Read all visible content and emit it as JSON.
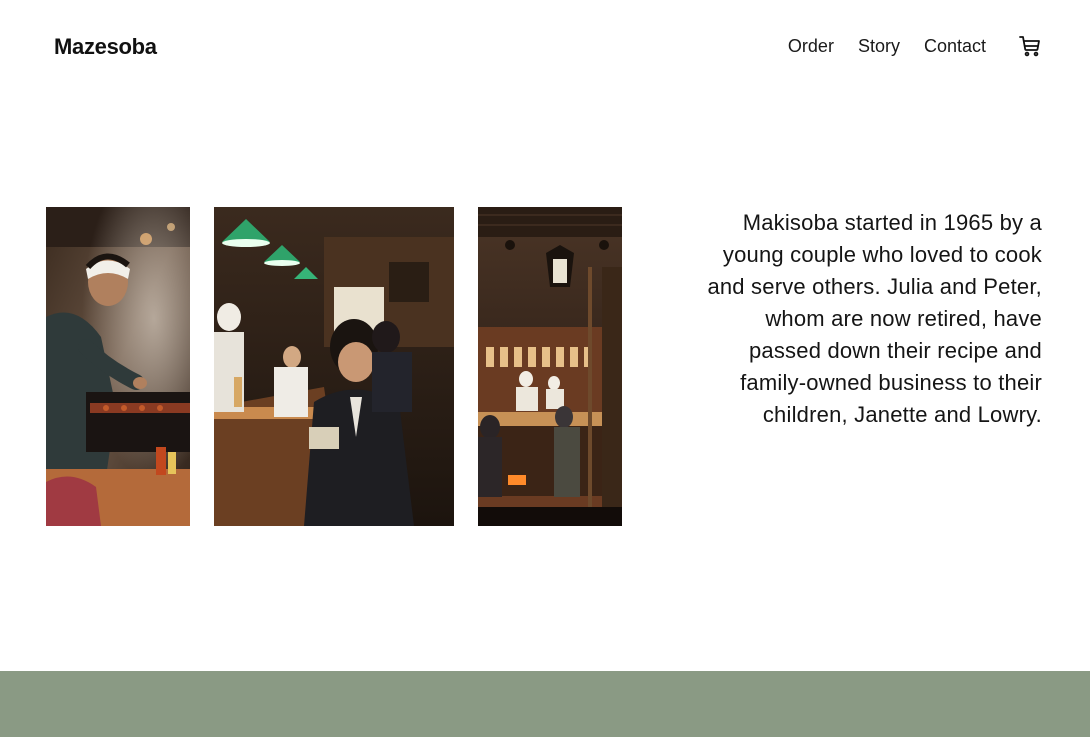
{
  "header": {
    "logo": "Mazesoba",
    "nav": [
      {
        "label": "Order"
      },
      {
        "label": "Story"
      },
      {
        "label": "Contact"
      }
    ],
    "cart_icon": "shopping-cart-icon"
  },
  "gallery": {
    "photos": [
      {
        "name": "chef-grilling-photo"
      },
      {
        "name": "diner-eating-noodles-photo"
      },
      {
        "name": "restaurant-entrance-photo"
      }
    ]
  },
  "story": {
    "text": "Makisoba started in 1965 by a young couple who loved to cook and serve others. Julia and Peter, whom are now retired, have passed down their recipe and family-owned business to their children, Janette and Lowry."
  },
  "colors": {
    "footer_band": "#8a9a84",
    "text": "#111111",
    "background": "#ffffff"
  }
}
